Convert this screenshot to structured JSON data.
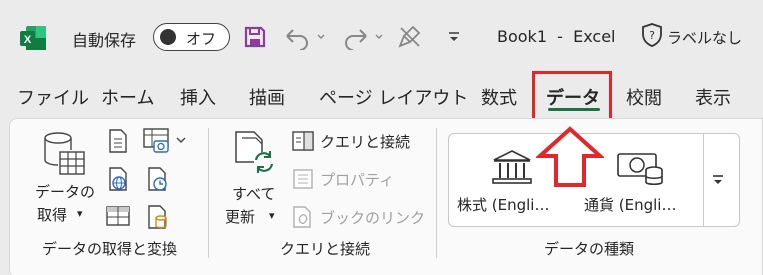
{
  "titlebar": {
    "app_icon": "excel-icon",
    "autosave_label": "自動保存",
    "toggle_state": "オフ",
    "doc_title": "Book1  -  Excel",
    "sensitivity_label": "ラベルなし",
    "icons": [
      "save-icon",
      "undo-icon",
      "redo-icon",
      "format-painter-icon",
      "customize-qat-icon",
      "shield-question-icon"
    ]
  },
  "tabs": [
    {
      "label": "ファイル",
      "active": false
    },
    {
      "label": "ホーム",
      "active": false
    },
    {
      "label": "挿入",
      "active": false
    },
    {
      "label": "描画",
      "active": false
    },
    {
      "label": "ページ レイアウト",
      "active": false
    },
    {
      "label": "数式",
      "active": false
    },
    {
      "label": "データ",
      "active": true
    },
    {
      "label": "校閲",
      "active": false
    },
    {
      "label": "表示",
      "active": false
    }
  ],
  "ribbon": {
    "get_data": {
      "button_line1": "データの",
      "button_line2": "取得",
      "group_label": "データの取得と変換"
    },
    "queries": {
      "refresh_line1": "すべて",
      "refresh_line2": "更新",
      "queries_connections": "クエリと接続",
      "properties": "プロパティ",
      "edit_links": "ブックのリンク",
      "group_label": "クエリと接続"
    },
    "data_types": {
      "stocks": "株式 (Engli…",
      "currencies": "通貨 (Engli…",
      "group_label": "データの種類"
    }
  },
  "colors": {
    "accent_green": "#1e7145",
    "highlight_red": "#e3262b",
    "save_purple": "#8e3b9e"
  }
}
